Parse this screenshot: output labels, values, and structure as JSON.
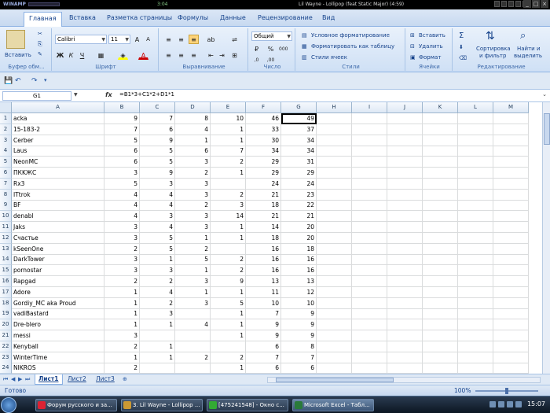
{
  "winamp": {
    "logo": "WINAMP",
    "time": "3:04",
    "title": "Lil Wayne - Lollipop (feat Static Major) (4:59)"
  },
  "ribbon_tabs": [
    "Главная",
    "Вставка",
    "Разметка страницы",
    "Формулы",
    "Данные",
    "Рецензирование",
    "Вид"
  ],
  "clipboard": {
    "paste": "Вставить",
    "group": "Буфер обм..."
  },
  "font": {
    "name": "Calibri",
    "size": "11",
    "group": "Шрифт"
  },
  "alignment": {
    "group": "Выравнивание"
  },
  "number": {
    "format": "Общий",
    "group": "Число"
  },
  "styles": {
    "conditional": "Условное форматирование",
    "as_table": "Форматировать как таблицу",
    "cell_styles": "Стили ячеек",
    "group": "Стили"
  },
  "cells": {
    "insert": "Вставить",
    "delete": "Удалить",
    "format": "Формат",
    "group": "Ячейки"
  },
  "editing": {
    "sort": "Сортировка",
    "sort2": "и фильтр",
    "find": "Найти и",
    "find2": "выделить",
    "group": "Редактирование"
  },
  "formula_bar": {
    "name_box": "G1",
    "fx": "fx",
    "formula": "=B1*3+C1*2+D1*1"
  },
  "columns": [
    "A",
    "B",
    "C",
    "D",
    "E",
    "F",
    "G",
    "H",
    "I",
    "J",
    "K",
    "L",
    "M"
  ],
  "rows": [
    {
      "n": "1",
      "a": "acka",
      "b": "9",
      "c": "7",
      "d": "8",
      "e": "10",
      "f": "46",
      "g": "49"
    },
    {
      "n": "2",
      "a": "15-183-2",
      "b": "7",
      "c": "6",
      "d": "4",
      "e": "1",
      "f": "33",
      "g": "37"
    },
    {
      "n": "3",
      "a": "Cerber",
      "b": "5",
      "c": "9",
      "d": "1",
      "e": "1",
      "f": "30",
      "g": "34"
    },
    {
      "n": "4",
      "a": "Laus",
      "b": "6",
      "c": "5",
      "d": "6",
      "e": "7",
      "f": "34",
      "g": "34"
    },
    {
      "n": "5",
      "a": "NeonMC",
      "b": "6",
      "c": "5",
      "d": "3",
      "e": "2",
      "f": "29",
      "g": "31"
    },
    {
      "n": "6",
      "a": "ПКKЖC",
      "b": "3",
      "c": "9",
      "d": "2",
      "e": "1",
      "f": "29",
      "g": "29"
    },
    {
      "n": "7",
      "a": "Rx3",
      "b": "5",
      "c": "3",
      "d": "3",
      "e": "",
      "f": "24",
      "g": "24"
    },
    {
      "n": "8",
      "a": "ITtrok",
      "b": "4",
      "c": "4",
      "d": "3",
      "e": "2",
      "f": "21",
      "g": "23"
    },
    {
      "n": "9",
      "a": "BF",
      "b": "4",
      "c": "4",
      "d": "2",
      "e": "3",
      "f": "18",
      "g": "22"
    },
    {
      "n": "10",
      "a": "denabl",
      "b": "4",
      "c": "3",
      "d": "3",
      "e": "14",
      "f": "21",
      "g": "21"
    },
    {
      "n": "11",
      "a": "Jaks",
      "b": "3",
      "c": "4",
      "d": "3",
      "e": "1",
      "f": "14",
      "g": "20"
    },
    {
      "n": "12",
      "a": "Счастье",
      "b": "3",
      "c": "5",
      "d": "1",
      "e": "1",
      "f": "18",
      "g": "20"
    },
    {
      "n": "13",
      "a": "kSeenOne",
      "b": "2",
      "c": "5",
      "d": "2",
      "e": "",
      "f": "16",
      "g": "18"
    },
    {
      "n": "14",
      "a": "DarkTower",
      "b": "3",
      "c": "1",
      "d": "5",
      "e": "2",
      "f": "16",
      "g": "16"
    },
    {
      "n": "15",
      "a": "pornostar",
      "b": "3",
      "c": "3",
      "d": "1",
      "e": "2",
      "f": "16",
      "g": "16"
    },
    {
      "n": "16",
      "a": "Rapgad",
      "b": "2",
      "c": "2",
      "d": "3",
      "e": "9",
      "f": "13",
      "g": "13"
    },
    {
      "n": "17",
      "a": "Adore",
      "b": "1",
      "c": "4",
      "d": "1",
      "e": "1",
      "f": "11",
      "g": "12"
    },
    {
      "n": "18",
      "a": "Gordiy_MC aka Proud",
      "b": "1",
      "c": "2",
      "d": "3",
      "e": "5",
      "f": "10",
      "g": "10"
    },
    {
      "n": "19",
      "a": "vadiBastard",
      "b": "1",
      "c": "3",
      "d": "",
      "e": "1",
      "f": "7",
      "g": "9"
    },
    {
      "n": "20",
      "a": "Dre-blero",
      "b": "1",
      "c": "1",
      "d": "4",
      "e": "1",
      "f": "9",
      "g": "9"
    },
    {
      "n": "21",
      "a": "messi",
      "b": "3",
      "c": "",
      "d": "",
      "e": "1",
      "f": "9",
      "g": "9"
    },
    {
      "n": "22",
      "a": "Kenyball",
      "b": "2",
      "c": "1",
      "d": "",
      "e": "",
      "f": "6",
      "g": "8"
    },
    {
      "n": "23",
      "a": "WinterTime",
      "b": "1",
      "c": "1",
      "d": "2",
      "e": "2",
      "f": "7",
      "g": "7"
    },
    {
      "n": "24",
      "a": "NIKROS",
      "b": "2",
      "c": "",
      "d": "",
      "e": "1",
      "f": "6",
      "g": "6"
    }
  ],
  "sheets": [
    "Лист1",
    "Лист2",
    "Лист3"
  ],
  "status": {
    "ready": "Готово",
    "zoom": "100%"
  },
  "taskbar": {
    "items": [
      "Форум русского и за...",
      "3. Lil Wayne - Lollipop ...",
      "[475241548] - Окно с...",
      "Microsoft Excel - Табл..."
    ],
    "clock": "15:07"
  }
}
